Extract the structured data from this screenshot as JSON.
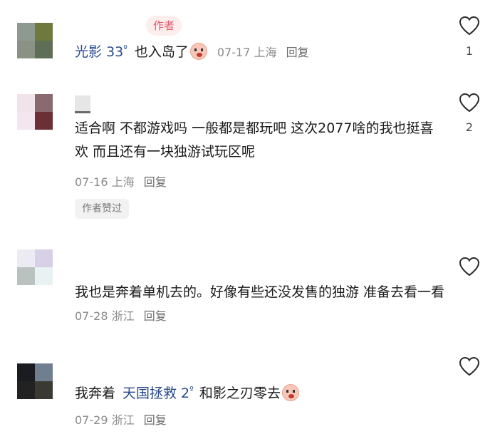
{
  "comments": [
    {
      "author_tag": "作者",
      "username": "光影",
      "username_num": "33",
      "username_sup": "º",
      "text": "也入岛了",
      "emoji_icon": "shy-face-emoji",
      "date": "07-17",
      "location": "上海",
      "reply": "回复",
      "like_count": "1",
      "avatar_colors": [
        "#8e9a8f",
        "#6e7a3d",
        "#8a9286",
        "#5f6f57"
      ]
    },
    {
      "text": "适合啊 不都游戏吗 一般都是都玩吧 这次2077啥的我也挺喜欢 而且还有一块独游试玩区呢",
      "date": "07-16",
      "location": "上海",
      "reply": "回复",
      "liked_chip": "作者赞过",
      "like_count": "2",
      "avatar_colors": [
        "#f0e4ea",
        "#8a6a6e",
        "#f3e6ee",
        "#6b2f36"
      ]
    },
    {
      "text": "我也是奔着单机去的。好像有些还没发售的独游 准备去看一看",
      "date": "07-28",
      "location": "浙江",
      "reply": "回复",
      "like_count": "",
      "avatar_colors": [
        "#ecebf3",
        "#d8d0e6",
        "#b9c2be",
        "#e8f2f2"
      ]
    },
    {
      "text_prefix": "我奔着",
      "link_text": "天国拯救 2",
      "link_sup": "º",
      "text_suffix": "和影之刃零去",
      "emoji_icon": "shy-face-emoji",
      "date": "07-29",
      "location": "浙江",
      "reply": "回复",
      "like_count": "",
      "avatar_colors": [
        "#1a1c22",
        "#6f7f8f",
        "#222222",
        "#3a3a32"
      ]
    }
  ]
}
